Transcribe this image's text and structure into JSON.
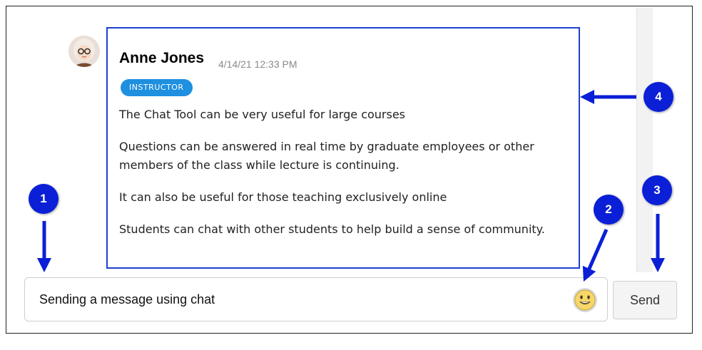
{
  "message": {
    "author": "Anne Jones",
    "timestamp": "4/14/21 12:33 PM",
    "role_badge": "INSTRUCTOR",
    "lines": [
      "The Chat Tool can be very useful for large courses",
      "Questions can be answered in real time by graduate employees or other members of the class while lecture is continuing.",
      "It can also be useful for those teaching exclusively online",
      "Students can chat with other students to help build a sense of community."
    ]
  },
  "composer": {
    "input_value": "Sending a message using chat",
    "send_label": "Send"
  },
  "callouts": [
    "1",
    "2",
    "3",
    "4"
  ],
  "colors": {
    "callout": "#0a1fd6",
    "highlight_border": "#1f3fd0",
    "badge": "#1f8fe0"
  },
  "icons": {
    "emoji": "smiley-face-icon",
    "avatar": "user-avatar-icon"
  }
}
